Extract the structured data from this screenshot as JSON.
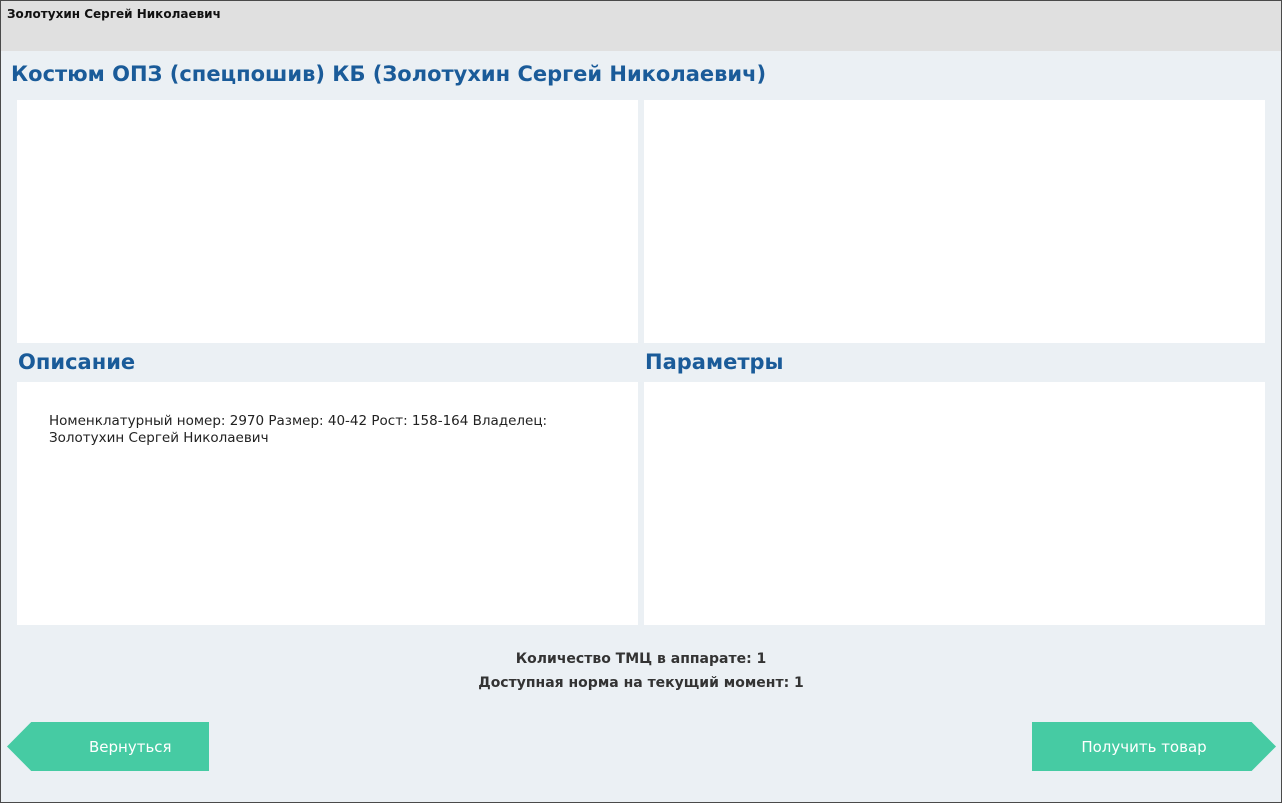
{
  "window": {
    "title": "Золотухин Сергей Николаевич"
  },
  "product": {
    "title": "Костюм ОПЗ (спецпошив) КБ (Золотухин Сергей Николаевич)"
  },
  "description": {
    "heading": "Описание",
    "text": "Номенклатурный номер: 2970 Размер: 40-42 Рост: 158-164 Владелец: Золотухин Сергей Николаевич"
  },
  "parameters": {
    "heading": "Параметры"
  },
  "info": {
    "quantity": "Количество ТМЦ в аппарате: 1",
    "norm": "Доступная норма на текущий момент: 1"
  },
  "buttons": {
    "back_label": "Вернуться",
    "get_label": "Получить товар",
    "accent_color": "#46cba3"
  }
}
